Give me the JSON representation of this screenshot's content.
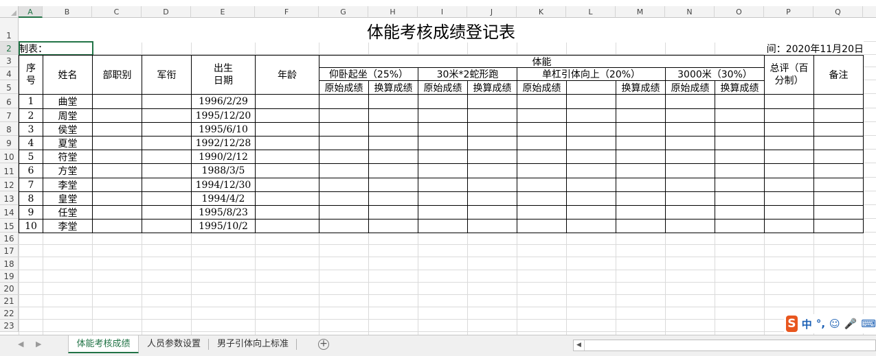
{
  "columns": [
    "A",
    "B",
    "C",
    "D",
    "E",
    "F",
    "G",
    "H",
    "I",
    "J",
    "K",
    "L",
    "M",
    "N",
    "O",
    "P",
    "Q"
  ],
  "rows": [
    "1",
    "2",
    "3",
    "4",
    "5",
    "6",
    "7",
    "8",
    "9",
    "10",
    "11",
    "12",
    "13",
    "14",
    "15",
    "16",
    "17",
    "18",
    "19",
    "20",
    "21",
    "22",
    "23"
  ],
  "sheet": {
    "title": "体能考核成绩登记表",
    "maker_label": "制表：",
    "date_text": "间：2020年11月20日",
    "headers": {
      "seq": "序\n号",
      "name": "姓名",
      "dept": "部职别",
      "rank": "军衔",
      "birth": "出生\n日期",
      "age": "年龄",
      "fitness": "体能",
      "situp": "仰卧起坐（25%）",
      "snake": "30米*2蛇形跑",
      "pullup": "单杠引体向上（20%）",
      "run3000": "3000米（30%）",
      "total": "总评（百\n分制）",
      "remark": "备注",
      "raw": "原始成绩",
      "conv": "换算成绩"
    },
    "records": [
      {
        "seq": "1",
        "name": "曲堂",
        "birth": "1996/2/29"
      },
      {
        "seq": "2",
        "name": "周堂",
        "birth": "1995/12/20"
      },
      {
        "seq": "3",
        "name": "侯堂",
        "birth": "1995/6/10"
      },
      {
        "seq": "4",
        "name": "夏堂",
        "birth": "1992/12/28"
      },
      {
        "seq": "5",
        "name": "符堂",
        "birth": "1990/2/12"
      },
      {
        "seq": "6",
        "name": "方堂",
        "birth": "1988/3/5"
      },
      {
        "seq": "7",
        "name": "李堂",
        "birth": "1994/12/30"
      },
      {
        "seq": "8",
        "name": "皇堂",
        "birth": "1994/4/2"
      },
      {
        "seq": "9",
        "name": "任堂",
        "birth": "1995/8/23"
      },
      {
        "seq": "10",
        "name": "李堂",
        "birth": "1995/10/2"
      }
    ]
  },
  "tabs": [
    {
      "label": "体能考核成绩",
      "active": true
    },
    {
      "label": "人员参数设置",
      "active": false
    },
    {
      "label": "男子引体向上标准",
      "active": false
    }
  ],
  "ime": {
    "lang": "中",
    "punct": "°,",
    "icons": [
      "emoji-icon",
      "microphone-icon",
      "keyboard-icon"
    ]
  },
  "colors": {
    "accent": "#217346",
    "ime_logo": "#e8561e"
  }
}
